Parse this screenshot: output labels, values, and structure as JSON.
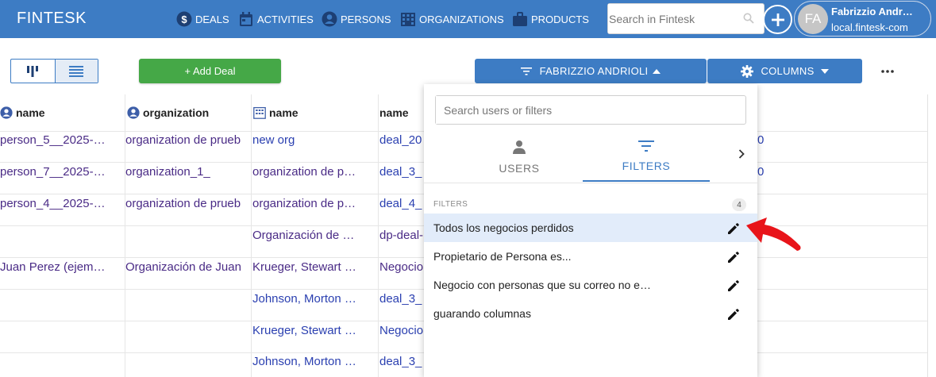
{
  "app": {
    "brand": "FINTESK",
    "nav": [
      {
        "label": "DEALS",
        "icon": "dollar-circle-icon"
      },
      {
        "label": "ACTIVITIES",
        "icon": "calendar-icon"
      },
      {
        "label": "PERSONS",
        "icon": "person-circle-icon"
      },
      {
        "label": "ORGANIZATIONS",
        "icon": "building-icon"
      },
      {
        "label": "PRODUCTS",
        "icon": "briefcase-icon"
      }
    ],
    "search_placeholder": "Search in Fintesk",
    "user": {
      "initials": "FA",
      "name": "Fabrizzio Andr…",
      "host": "local.fintesk-com"
    }
  },
  "toolbar": {
    "add_deal_label": "+ Add Deal",
    "filter_label": "FABRIZZIO ANDRIOLI",
    "columns_label": "COLUMNS"
  },
  "table": {
    "headers": [
      {
        "label": "name",
        "icon": "person-circle-icon"
      },
      {
        "label": "organization",
        "icon": "person-circle-icon"
      },
      {
        "label": "name",
        "icon": "building-icon"
      },
      {
        "label": "name",
        "icon": ""
      }
    ],
    "rows": [
      [
        "person_5__2025-…",
        "organization de prueb",
        "new org",
        "deal_20"
      ],
      [
        "person_7__2025-…",
        "organization_1_",
        "organization de p…",
        "deal_3_"
      ],
      [
        "person_4__2025-…",
        "organization de prueb",
        "organization de p…",
        "deal_4_"
      ],
      [
        "",
        "",
        "Organización de …",
        "dp-deal-"
      ],
      [
        "Juan Perez (ejem…",
        "Organización de Juan",
        "Krueger, Stewart …",
        "Negocio"
      ],
      [
        "",
        "",
        "Johnson, Morton …",
        "deal_3_"
      ],
      [
        "",
        "",
        "Krueger, Stewart …",
        "Negocio"
      ],
      [
        "",
        "",
        "Johnson, Morton …",
        "deal_3_"
      ]
    ],
    "edge_fragments": [
      "0",
      "0"
    ]
  },
  "panel": {
    "search_placeholder": "Search users or filters",
    "tabs": [
      {
        "label": "USERS",
        "icon": "person-icon",
        "active": false
      },
      {
        "label": "FILTERS",
        "icon": "filter-icon",
        "active": true
      }
    ],
    "section_label": "FILTERS",
    "section_count": "4",
    "filters": [
      {
        "label": "Todos los negocios perdidos",
        "selected": true
      },
      {
        "label": "Propietario de Persona es...",
        "selected": false
      },
      {
        "label": "Negocio con personas que su correo no e…",
        "selected": false
      },
      {
        "label": "guarando columnas",
        "selected": false
      }
    ]
  },
  "colors": {
    "primary": "#3d7cc4",
    "success": "#45a847",
    "annotation_arrow": "#e8141a"
  }
}
